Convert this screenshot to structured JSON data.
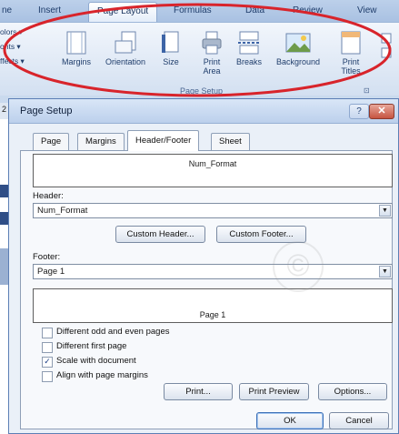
{
  "ribbon": {
    "tabs": [
      "ne",
      "Insert",
      "Page Layout",
      "Formulas",
      "Data",
      "Review",
      "View"
    ],
    "left_items": [
      "olors ▾",
      "onts ▾",
      "ffects ▾"
    ],
    "buttons": [
      "Margins",
      "Orientation",
      "Size",
      "Print Area",
      "Breaks",
      "Background",
      "Print Titles"
    ],
    "group_label": "Page Setup"
  },
  "dialog": {
    "title": "Page Setup",
    "help_label": "?",
    "close_label": "✕",
    "tabs": [
      "Page",
      "Margins",
      "Header/Footer",
      "Sheet"
    ],
    "active_tab": "Header/Footer",
    "header_preview": "Num_Format",
    "header_label": "Header:",
    "header_value": "Num_Format",
    "custom_header_label": "Custom Header...",
    "custom_footer_label": "Custom Footer...",
    "footer_label": "Footer:",
    "footer_value": "Page 1",
    "footer_preview": "Page 1",
    "options": [
      {
        "label": "Different odd and even pages",
        "checked": false
      },
      {
        "label": "Different first page",
        "checked": false
      },
      {
        "label": "Scale with document",
        "checked": true
      },
      {
        "label": "Align with page margins",
        "checked": false
      }
    ],
    "print_label": "Print...",
    "print_preview_label": "Print Preview",
    "options_label": "Options...",
    "ok_label": "OK",
    "cancel_label": "Cancel"
  },
  "annotation": {
    "color": "#d8242b"
  },
  "sidebar": {
    "row_number": "2"
  }
}
